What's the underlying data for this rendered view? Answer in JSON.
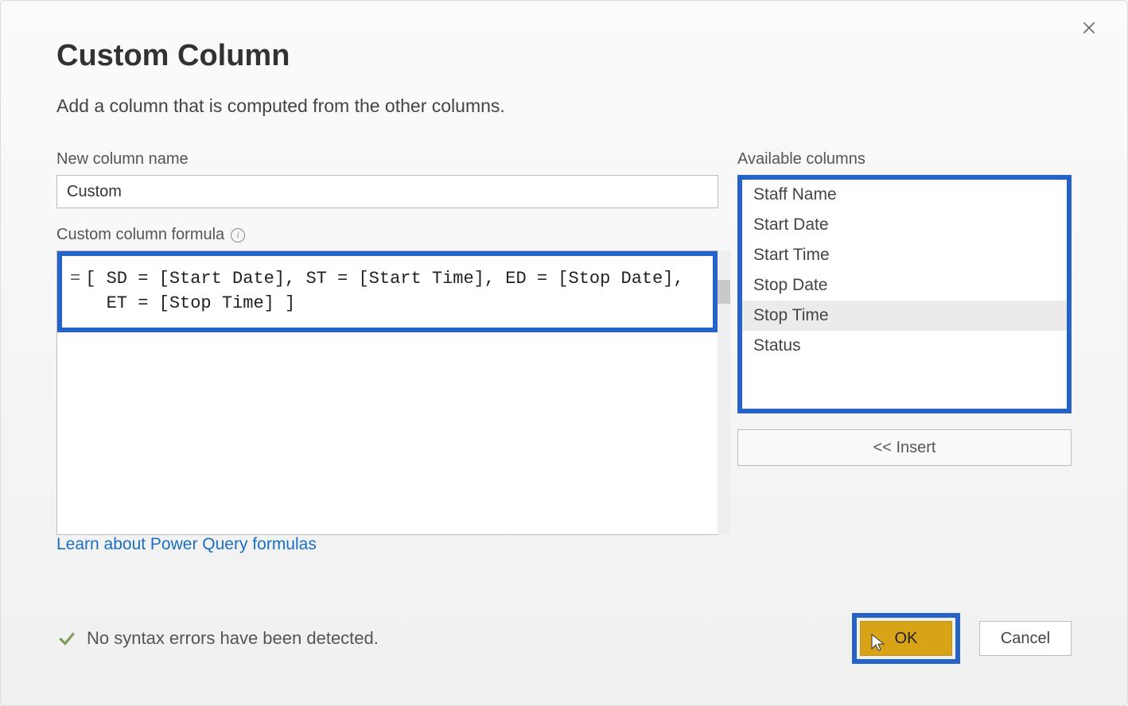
{
  "dialog": {
    "title": "Custom Column",
    "subtitle": "Add a column that is computed from the other columns."
  },
  "newColumnName": {
    "label": "New column name",
    "value": "Custom"
  },
  "formula": {
    "label": "Custom column formula",
    "body": "[ SD = [Start Date], ST = [Start Time], ED = [Stop Date],\n  ET = [Stop Time] ]"
  },
  "learnLink": "Learn about Power Query formulas",
  "availableColumns": {
    "label": "Available columns",
    "items": [
      "Staff Name",
      "Start Date",
      "Start Time",
      "Stop Date",
      "Stop Time",
      "Status"
    ],
    "selectedIndex": 4,
    "insertLabel": "<< Insert"
  },
  "status": {
    "message": "No syntax errors have been detected."
  },
  "buttons": {
    "ok": "OK",
    "cancel": "Cancel"
  }
}
